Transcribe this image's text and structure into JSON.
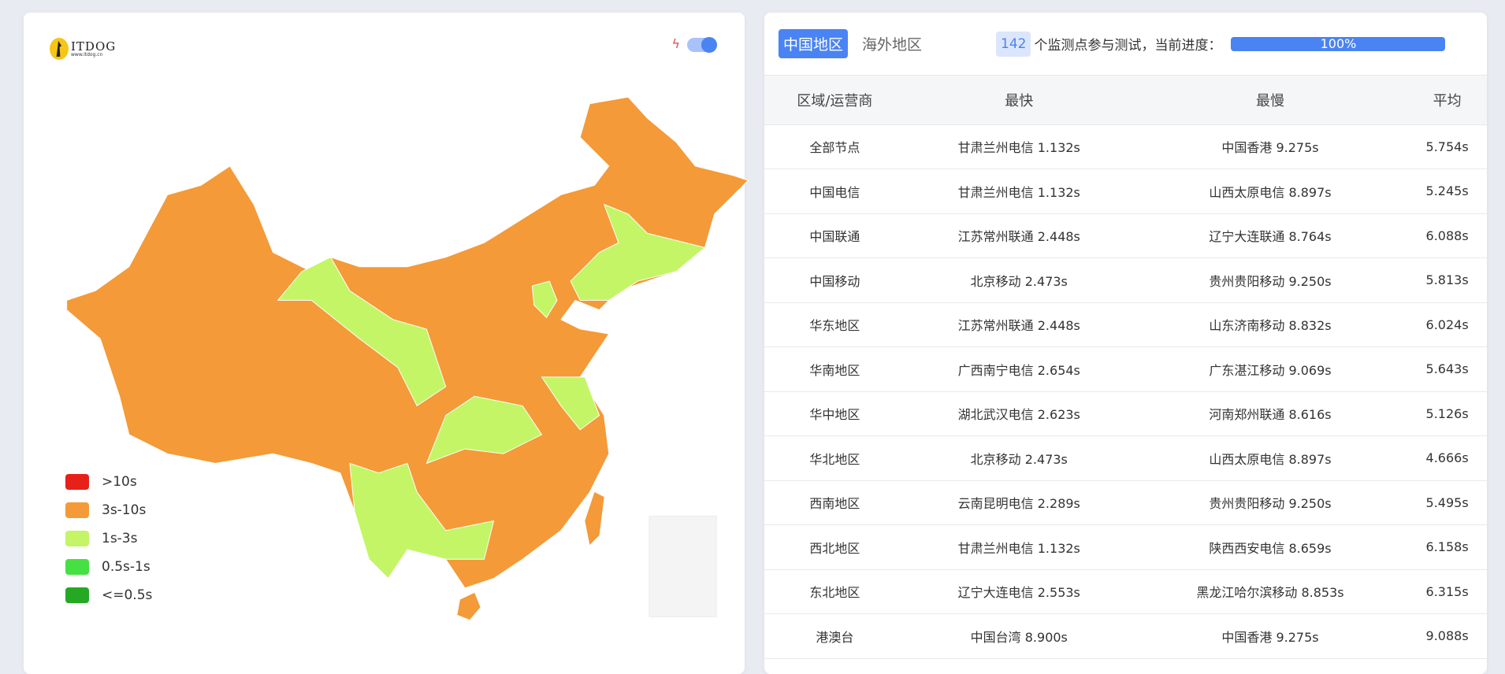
{
  "left_panel": {
    "logo_text": "ITDOG",
    "logo_sub": "www.itdog.cn",
    "toggle_on": true,
    "legend": [
      {
        "label": ">10s",
        "color": "#e8201a"
      },
      {
        "label": "3s-10s",
        "color": "#f49a38"
      },
      {
        "label": "1s-3s",
        "color": "#c3f567"
      },
      {
        "label": "0.5s-1s",
        "color": "#45e041"
      },
      {
        "label": "<=0.5s",
        "color": "#25a925"
      }
    ]
  },
  "right_panel": {
    "tabs": [
      {
        "label": "中国地区",
        "active": true
      },
      {
        "label": "海外地区",
        "active": false
      }
    ],
    "node_count": "142",
    "status_text": "个监测点参与测试，当前进度：",
    "progress": "100%",
    "columns": [
      "区域/运营商",
      "最快",
      "最慢",
      "平均"
    ],
    "rows": [
      [
        "全部节点",
        "甘肃兰州电信 1.132s",
        "中国香港 9.275s",
        "5.754s"
      ],
      [
        "中国电信",
        "甘肃兰州电信 1.132s",
        "山西太原电信 8.897s",
        "5.245s"
      ],
      [
        "中国联通",
        "江苏常州联通 2.448s",
        "辽宁大连联通 8.764s",
        "6.088s"
      ],
      [
        "中国移动",
        "北京移动 2.473s",
        "贵州贵阳移动 9.250s",
        "5.813s"
      ],
      [
        "华东地区",
        "江苏常州联通 2.448s",
        "山东济南移动 8.832s",
        "6.024s"
      ],
      [
        "华南地区",
        "广西南宁电信 2.654s",
        "广东湛江移动 9.069s",
        "5.643s"
      ],
      [
        "华中地区",
        "湖北武汉电信 2.623s",
        "河南郑州联通 8.616s",
        "5.126s"
      ],
      [
        "华北地区",
        "北京移动 2.473s",
        "山西太原电信 8.897s",
        "4.666s"
      ],
      [
        "西南地区",
        "云南昆明电信 2.289s",
        "贵州贵阳移动 9.250s",
        "5.495s"
      ],
      [
        "西北地区",
        "甘肃兰州电信 1.132s",
        "陕西西安电信 8.659s",
        "6.158s"
      ],
      [
        "东北地区",
        "辽宁大连电信 2.553s",
        "黑龙江哈尔滨移动 8.853s",
        "6.315s"
      ],
      [
        "港澳台",
        "中国台湾 8.900s",
        "中国香港 9.275s",
        "9.088s"
      ]
    ]
  }
}
